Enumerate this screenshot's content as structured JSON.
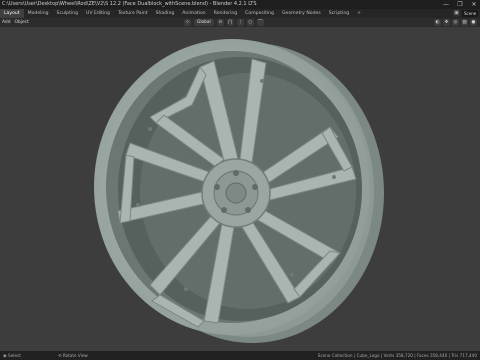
{
  "window": {
    "title": "C:\\Users\\User\\Desktop\\Wheel\\Rod\\ZE\\V2\\S 12.2 (Face Dualblock_withScene.blend) - Blender 4.2.1 LTS",
    "controls": [
      "—",
      "❐",
      "✕"
    ]
  },
  "workspace_tabs": [
    {
      "label": "Layout",
      "active": true
    },
    {
      "label": "Modeling",
      "active": false
    },
    {
      "label": "Sculpting",
      "active": false
    },
    {
      "label": "UV Editing",
      "active": false
    },
    {
      "label": "Texture Paint",
      "active": false
    },
    {
      "label": "Shading",
      "active": false
    },
    {
      "label": "Animation",
      "active": false
    },
    {
      "label": "Rendering",
      "active": false
    },
    {
      "label": "Compositing",
      "active": false
    },
    {
      "label": "Geometry Nodes",
      "active": false
    },
    {
      "label": "Scripting",
      "active": false
    },
    {
      "label": "+",
      "active": false
    }
  ],
  "scene": {
    "label": "Scene",
    "icon": "scene-icon"
  },
  "viewport_header": {
    "menus": [
      "Add",
      "Object"
    ],
    "transform_orientation": "Global",
    "snap_icon": "magnet-icon",
    "proportional_icon": "circle-icon"
  },
  "statusbar": {
    "left": "◉ Select",
    "mid": "⟲ Rotate View",
    "right": "Scene Collection | Cube_Logo | Verts 358,720 | Faces 358,440 | Tris 717,440"
  },
  "colors": {
    "viewport_bg": "#3d3d3d",
    "wheel_face": "#a6b2ad",
    "wheel_shadow": "#6f7c77",
    "wheel_dark": "#56615d"
  }
}
